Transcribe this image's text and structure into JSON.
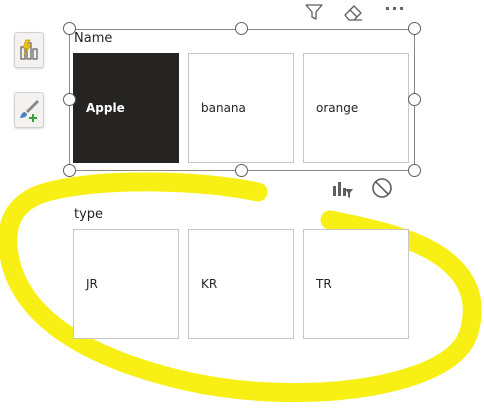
{
  "visual_header": {
    "icons": [
      "filter-icon",
      "eraser-icon",
      "more-options-icon"
    ],
    "more_label": "···"
  },
  "side_pane": {
    "buttons": [
      "build-visual-icon",
      "format-visual-icon"
    ]
  },
  "name_slicer": {
    "title": "Name",
    "items": [
      {
        "label": "Apple",
        "selected": true
      },
      {
        "label": "banana",
        "selected": false
      },
      {
        "label": "orange",
        "selected": false
      }
    ]
  },
  "type_slicer": {
    "title": "type",
    "items": [
      {
        "label": "JR",
        "selected": false
      },
      {
        "label": "KR",
        "selected": false
      },
      {
        "label": "TR",
        "selected": false
      }
    ]
  },
  "colors": {
    "selected_tile": "#252423",
    "highlight_marker": "#f7ef00",
    "accent": "#f2c811"
  }
}
